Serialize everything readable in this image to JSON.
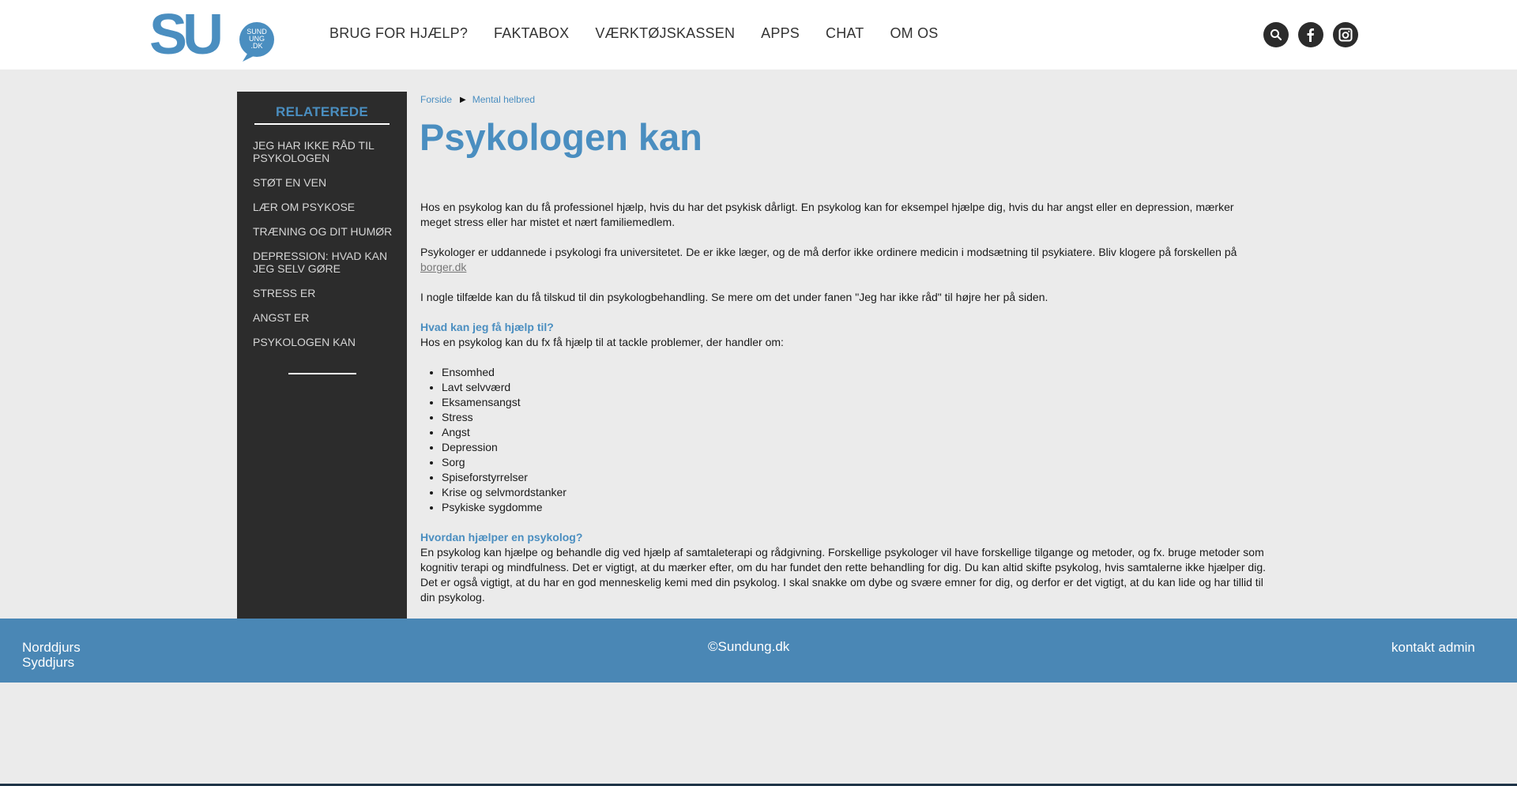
{
  "header": {
    "logo_text": "SU",
    "logo_badge": "SUND UNG .DK",
    "nav": [
      "BRUG FOR HJÆLP?",
      "FAKTABOX",
      "VÆRKTØJSKASSEN",
      "APPS",
      "CHAT",
      "OM OS"
    ],
    "social_icons": [
      "search-icon",
      "facebook-icon",
      "instagram-icon"
    ]
  },
  "sidebar": {
    "title": "RELATEREDE",
    "items": [
      "JEG HAR IKKE RÅD TIL PSYKOLOGEN",
      "STØT EN VEN",
      "LÆR OM PSYKOSE",
      "TRÆNING OG DIT HUMØR",
      "DEPRESSION: HVAD KAN JEG SELV GØRE",
      "STRESS ER",
      "ANGST ER",
      "PSYKOLOGEN KAN"
    ]
  },
  "breadcrumb": [
    "Forside",
    "Mental helbred"
  ],
  "page_title": "Psykologen kan",
  "content": {
    "p1": "Hos en psykolog kan du få professionel hjælp, hvis du har det psykisk dårligt. En psykolog kan for eksempel hjælpe dig, hvis du har angst eller en depression, mærker meget stress eller har mistet et nært familiemedlem.",
    "p2_before_link": "Psykologer er uddannede i psykologi fra universitetet. De er ikke læger, og de må derfor ikke ordinere medicin i modsætning til psykiatere. Bliv klogere på forskellen på ",
    "p2_link": "borger.dk",
    "p3": "I nogle tilfælde kan du få tilskud til din psykologbehandling. Se mere om det under fanen \"Jeg har ikke råd\" til højre her på siden.",
    "h1": "Hvad kan jeg få hjælp til?",
    "p4": "Hos en psykolog kan du fx få hjælp til at tackle problemer, der handler om:",
    "list": [
      "Ensomhed",
      "Lavt selvværd",
      "Eksamensangst",
      "Stress",
      "Angst",
      "Depression",
      "Sorg",
      "Spiseforstyrrelser",
      "Krise og selvmordstanker",
      "Psykiske sygdomme"
    ],
    "h2": "Hvordan hjælper en psykolog?",
    "p5": "En psykolog kan hjælpe og behandle dig ved hjælp af samtaleterapi og rådgivning. Forskellige psykologer vil have forskellige tilgange og metoder, og fx. bruge metoder som kognitiv terapi og mindfulness. Det er vigtigt, at du mærker efter, om du har fundet den rette behandling for dig. Du kan altid skifte psykolog, hvis samtalerne ikke hjælper dig. Det er også vigtigt, at du har en god menneskelig kemi med din psykolog. I skal snakke om dybe og svære emner for dig, og derfor er det vigtigt, at du kan lide og har tillid til din psykolog."
  },
  "footer": {
    "left_line1": "Norddjurs",
    "left_line2": "Syddjurs",
    "center": "©Sundung.dk",
    "right": "kontakt admin"
  },
  "colors": {
    "accent": "#4a8ec0",
    "footer": "#4a87b5",
    "sidebar": "#2c2c2c"
  }
}
